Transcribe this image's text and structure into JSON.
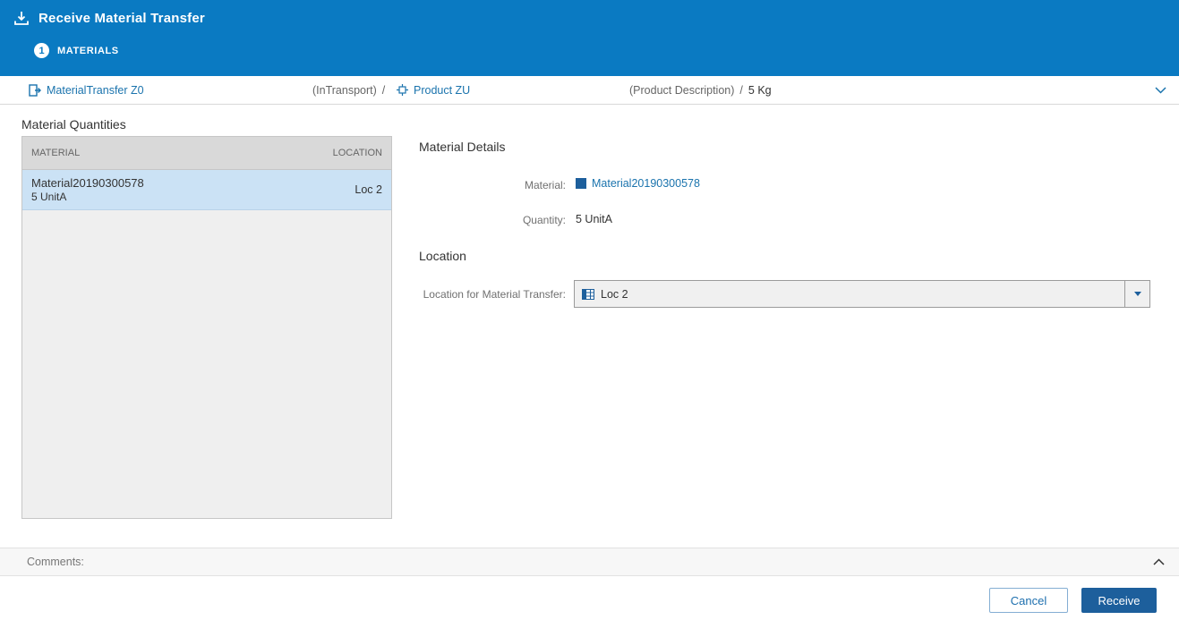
{
  "header": {
    "title": "Receive Material Transfer",
    "step": {
      "number": "1",
      "label": "MATERIALS"
    }
  },
  "breadcrumb": {
    "transfer": "MaterialTransfer Z0",
    "status": "(InTransport)",
    "sep1": "/",
    "product": "Product ZU",
    "description": "(Product Description)",
    "sep2": "/",
    "quantity": "5 Kg"
  },
  "material_quantities": {
    "title": "Material Quantities",
    "columns": {
      "material": "MATERIAL",
      "location": "LOCATION"
    },
    "rows": [
      {
        "material": "Material20190300578",
        "quantity": "5 UnitA",
        "location": "Loc 2"
      }
    ]
  },
  "material_details": {
    "title": "Material Details",
    "material_label": "Material:",
    "material_value": "Material20190300578",
    "quantity_label": "Quantity:",
    "quantity_value": "5 UnitA"
  },
  "location_section": {
    "title": "Location",
    "field_label": "Location for Material Transfer:",
    "field_value": "Loc 2"
  },
  "comments": {
    "label": "Comments:"
  },
  "footer": {
    "cancel": "Cancel",
    "receive": "Receive"
  },
  "colors": {
    "header_blue": "#0a7ac2",
    "link_blue": "#1a73ad",
    "primary_blue": "#1d5f9c",
    "selected_row": "#cbe2f5",
    "table_header_gray": "#d9d9d9"
  }
}
